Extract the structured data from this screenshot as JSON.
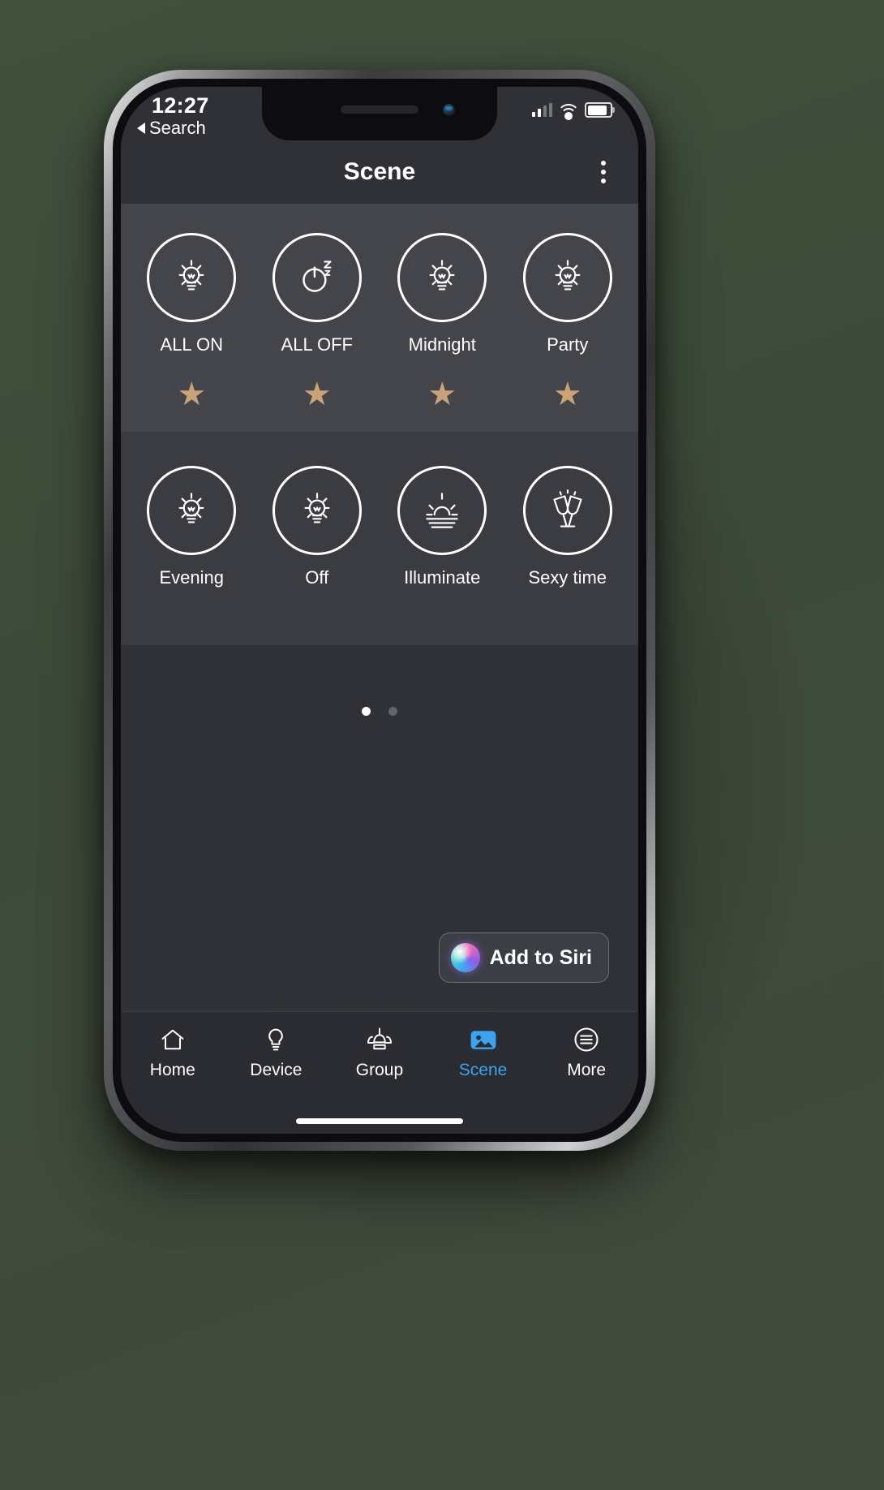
{
  "status_bar": {
    "time": "12:27",
    "back_label": "Search",
    "signal_icon": "cellular-signal-icon",
    "wifi_icon": "wifi-icon",
    "battery_icon": "battery-icon"
  },
  "nav": {
    "title": "Scene",
    "more_icon": "overflow-menu-icon"
  },
  "scenes": {
    "row1": [
      {
        "label": "ALL ON",
        "icon": "lightbulb-on-icon",
        "favorite": true
      },
      {
        "label": "ALL OFF",
        "icon": "power-sleep-icon",
        "favorite": true
      },
      {
        "label": "Midnight",
        "icon": "lightbulb-on-icon",
        "favorite": true
      },
      {
        "label": "Party",
        "icon": "lightbulb-on-icon",
        "favorite": true
      }
    ],
    "row2": [
      {
        "label": "Evening",
        "icon": "lightbulb-on-icon",
        "favorite": false
      },
      {
        "label": "Off",
        "icon": "lightbulb-on-icon",
        "favorite": false
      },
      {
        "label": "Illuminate",
        "icon": "sunset-icon",
        "favorite": false
      },
      {
        "label": "Sexy time",
        "icon": "champagne-glasses-icon",
        "favorite": false
      }
    ],
    "star_color": "#c9a276"
  },
  "pager": {
    "total": 2,
    "active_index": 0
  },
  "siri": {
    "label": "Add to Siri",
    "icon": "siri-orb-icon"
  },
  "tabbar": {
    "active_color": "#3ea2f0",
    "items": [
      {
        "label": "Home",
        "icon": "home-icon",
        "active": false
      },
      {
        "label": "Device",
        "icon": "bulb-icon",
        "active": false
      },
      {
        "label": "Group",
        "icon": "group-icon",
        "active": false
      },
      {
        "label": "Scene",
        "icon": "photo-icon",
        "active": true
      },
      {
        "label": "More",
        "icon": "more-list-icon",
        "active": false
      }
    ]
  }
}
